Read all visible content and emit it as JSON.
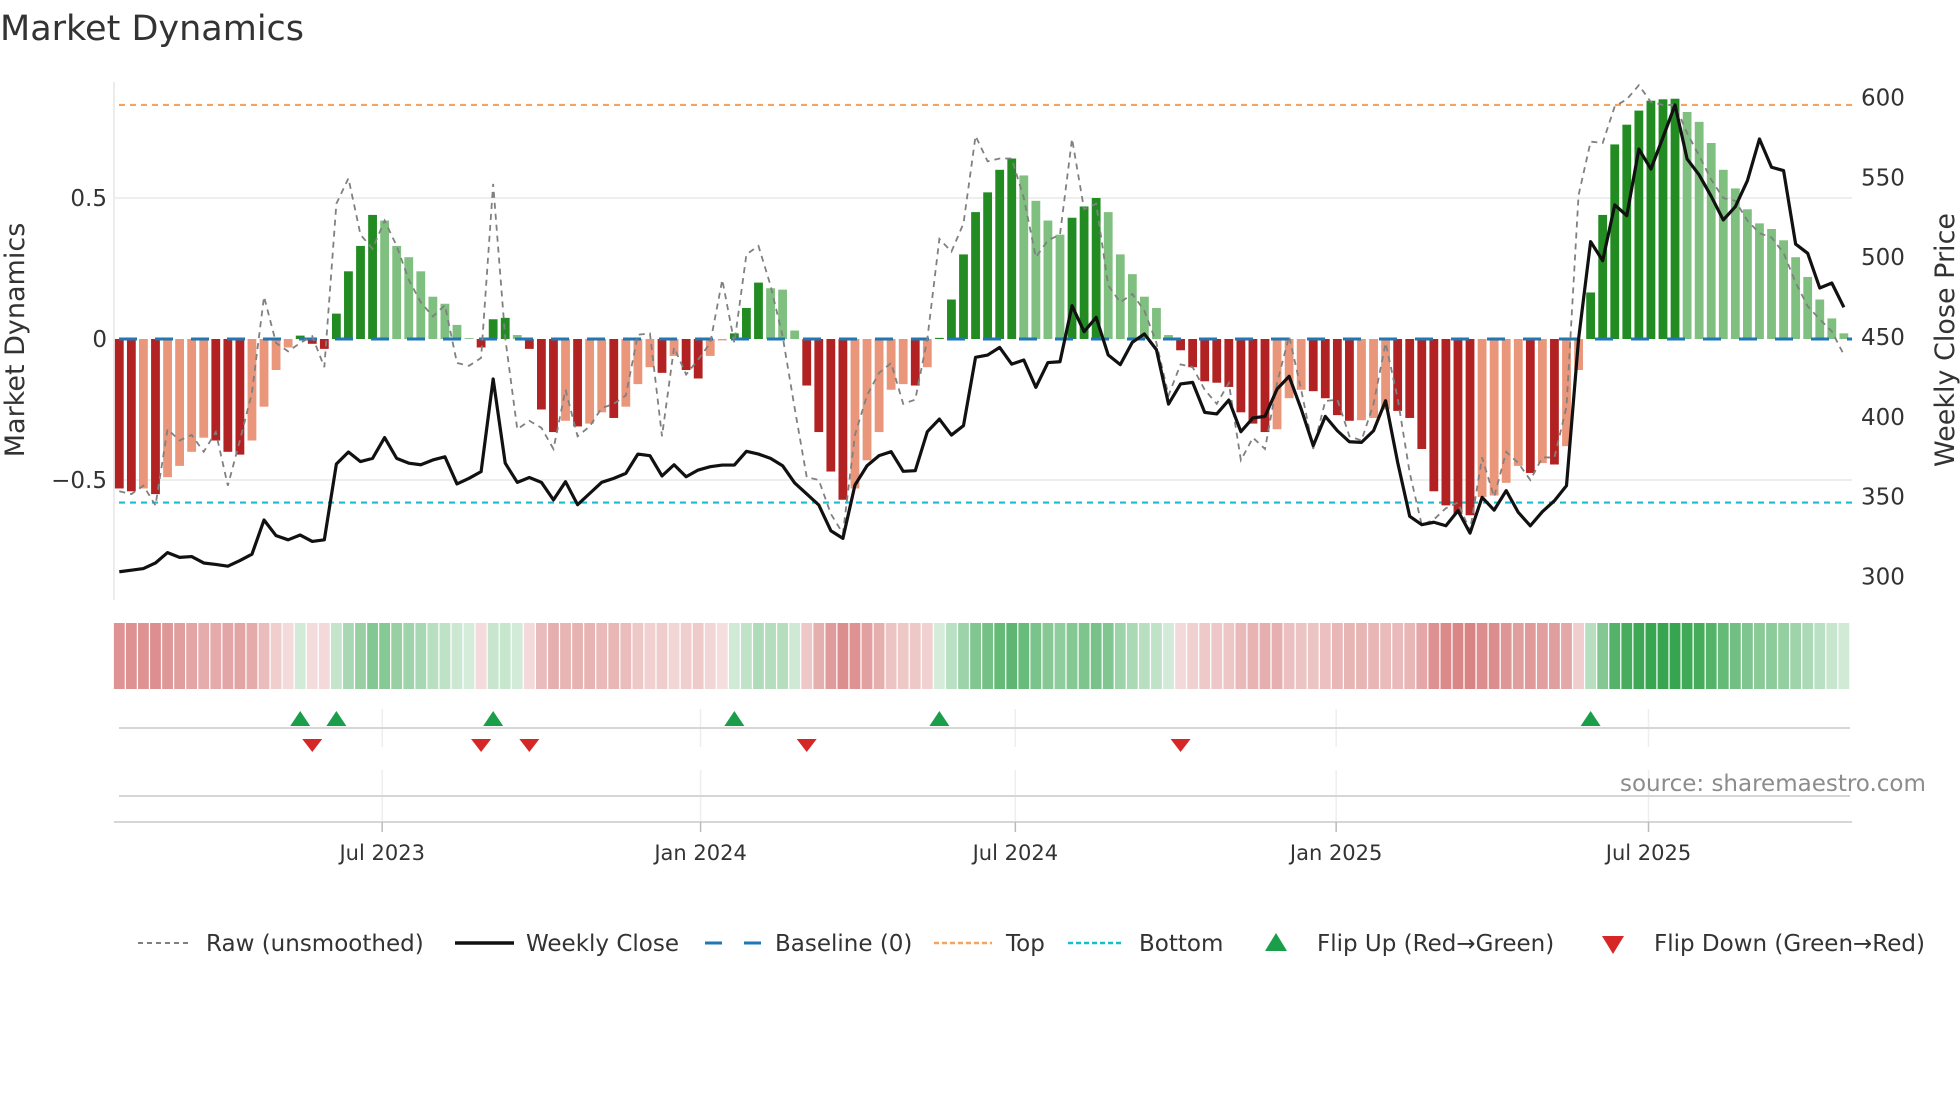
{
  "title": "Market Dynamics",
  "source": "source: sharemaestro.com",
  "colors": {
    "bar_neg_falling": "#b22222",
    "bar_neg_rising": "#e9967a",
    "bar_pos_rising": "#228b22",
    "bar_pos_falling": "#7fbf7f",
    "raw": "#808080",
    "close": "#111111",
    "baseline": "#1f77b4",
    "top": "#f4a460",
    "bottom": "#17becf",
    "flip_up": "#1a9e4a",
    "flip_down": "#d62728"
  },
  "chart_data": {
    "type": "bar",
    "title": "Market Dynamics",
    "ylabel": "Market Dynamics",
    "y2label": "Weekly Close Price",
    "ylim": [
      -0.92,
      0.91
    ],
    "y2lim": [
      282,
      610
    ],
    "yticks": [
      {
        "value": 0.5,
        "label": "0.5"
      },
      {
        "value": 0,
        "label": "0"
      },
      {
        "value": -0.5,
        "label": "−0.5"
      }
    ],
    "y2ticks": [
      {
        "value": 600,
        "label": "600"
      },
      {
        "value": 550,
        "label": "550"
      },
      {
        "value": 500,
        "label": "500"
      },
      {
        "value": 450,
        "label": "450"
      },
      {
        "value": 400,
        "label": "400"
      },
      {
        "value": 350,
        "label": "350"
      },
      {
        "value": 300,
        "label": "300"
      }
    ],
    "x_unit": "week index",
    "x_ticks": [
      {
        "label": "Jul 2023",
        "week": 21.8
      },
      {
        "label": "Jan 2024",
        "week": 48.2
      },
      {
        "label": "Jul 2024",
        "week": 74.3
      },
      {
        "label": "Jan 2025",
        "week": 100.9
      },
      {
        "label": "Jul 2025",
        "week": 126.8
      }
    ],
    "reference_lines": {
      "baseline": 0,
      "top": 0.83,
      "bottom": -0.58
    },
    "grid": true,
    "legend_position": "bottom",
    "legend": [
      {
        "key": "raw",
        "label": "Raw (unsmoothed)"
      },
      {
        "key": "close",
        "label": "Weekly Close"
      },
      {
        "key": "baseline",
        "label": "Baseline (0)"
      },
      {
        "key": "top",
        "label": "Top"
      },
      {
        "key": "bottom",
        "label": "Bottom"
      },
      {
        "key": "flip_up",
        "label": "Flip Up (Red→Green)"
      },
      {
        "key": "flip_down",
        "label": "Flip Down (Green→Red)"
      }
    ],
    "series": [
      {
        "name": "Market Dynamics",
        "values": [
          -0.53,
          -0.54,
          -0.53,
          -0.55,
          -0.49,
          -0.45,
          -0.4,
          -0.35,
          -0.36,
          -0.4,
          -0.41,
          -0.36,
          -0.24,
          -0.11,
          -0.03,
          0.012,
          -0.017,
          -0.035,
          0.09,
          0.24,
          0.33,
          0.44,
          0.42,
          0.33,
          0.29,
          0.24,
          0.15,
          0.125,
          0.05,
          0.003,
          -0.03,
          0.07,
          0.075,
          0.014,
          -0.035,
          -0.25,
          -0.33,
          -0.29,
          -0.31,
          -0.3,
          -0.26,
          -0.28,
          -0.24,
          -0.16,
          -0.1,
          -0.12,
          -0.06,
          -0.11,
          -0.14,
          -0.06,
          -0.005,
          0.02,
          0.11,
          0.2,
          0.18,
          0.175,
          0.03,
          -0.165,
          -0.33,
          -0.47,
          -0.57,
          -0.53,
          -0.43,
          -0.33,
          -0.18,
          -0.16,
          -0.165,
          -0.1,
          0.004,
          0.14,
          0.3,
          0.45,
          0.52,
          0.6,
          0.64,
          0.58,
          0.49,
          0.42,
          0.37,
          0.43,
          0.47,
          0.5,
          0.45,
          0.3,
          0.23,
          0.15,
          0.11,
          0.014,
          -0.04,
          -0.1,
          -0.15,
          -0.155,
          -0.17,
          -0.26,
          -0.3,
          -0.33,
          -0.32,
          -0.21,
          -0.18,
          -0.185,
          -0.21,
          -0.27,
          -0.29,
          -0.288,
          -0.28,
          -0.25,
          -0.255,
          -0.28,
          -0.39,
          -0.54,
          -0.59,
          -0.62,
          -0.625,
          -0.56,
          -0.555,
          -0.51,
          -0.45,
          -0.475,
          -0.44,
          -0.445,
          -0.38,
          -0.11,
          0.165,
          0.44,
          0.69,
          0.76,
          0.81,
          0.845,
          0.85,
          0.852,
          0.805,
          0.77,
          0.695,
          0.6,
          0.534,
          0.46,
          0.41,
          0.39,
          0.35,
          0.29,
          0.22,
          0.14,
          0.073,
          0.02
        ]
      },
      {
        "name": "Raw (unsmoothed)",
        "values": [
          -0.54,
          -0.55,
          -0.52,
          -0.59,
          -0.32,
          -0.36,
          -0.34,
          -0.4,
          -0.33,
          -0.52,
          -0.36,
          -0.19,
          0.15,
          -0.014,
          -0.044,
          -0.014,
          0.01,
          -0.1,
          0.48,
          0.57,
          0.37,
          0.32,
          0.42,
          0.33,
          0.21,
          0.13,
          0.08,
          0.12,
          -0.085,
          -0.095,
          -0.067,
          0.55,
          0.004,
          -0.32,
          -0.29,
          -0.315,
          -0.39,
          -0.18,
          -0.345,
          -0.31,
          -0.245,
          -0.23,
          -0.2,
          0.015,
          0.02,
          -0.345,
          -0.03,
          -0.126,
          -0.073,
          -0.014,
          0.21,
          -0.014,
          0.3,
          0.33,
          0.19,
          0.01,
          -0.245,
          -0.49,
          -0.5,
          -0.62,
          -0.69,
          -0.34,
          -0.2,
          -0.12,
          -0.085,
          -0.23,
          -0.215,
          0,
          0.355,
          0.31,
          0.41,
          0.72,
          0.63,
          0.64,
          0.64,
          0.5,
          0.29,
          0.35,
          0.37,
          0.71,
          0.46,
          0.48,
          0.19,
          0.13,
          0.16,
          0.1,
          -0.014,
          -0.2,
          -0.09,
          -0.1,
          -0.18,
          -0.23,
          -0.156,
          -0.43,
          -0.35,
          -0.39,
          -0.156,
          0.01,
          -0.18,
          -0.39,
          -0.22,
          -0.215,
          -0.345,
          -0.36,
          -0.23,
          -0.014,
          -0.21,
          -0.475,
          -0.66,
          -0.64,
          -0.6,
          -0.58,
          -0.68,
          -0.42,
          -0.56,
          -0.4,
          -0.44,
          -0.5,
          -0.42,
          -0.42,
          -0.24,
          0.51,
          0.7,
          0.695,
          0.825,
          0.85,
          0.9,
          0.84,
          0.83,
          0.83,
          0.73,
          0.65,
          0.565,
          0.5,
          0.49,
          0.42,
          0.375,
          0.36,
          0.305,
          0.2,
          0.116,
          0.07,
          0.027,
          -0.056
        ]
      },
      {
        "name": "Weekly Close",
        "axis": "right",
        "values": [
          303,
          304,
          305,
          308.5,
          315,
          312,
          312.5,
          308.5,
          307.6,
          306.5,
          310,
          314,
          335.4,
          325.6,
          323,
          326,
          322,
          323,
          370.5,
          378,
          372,
          374,
          387,
          374,
          371,
          370,
          373,
          375,
          358,
          361.5,
          365.7,
          423.7,
          371,
          359,
          362,
          359,
          348,
          359.4,
          345,
          352,
          359,
          361.5,
          364.6,
          376.7,
          375.7,
          363,
          370,
          362.5,
          366.7,
          368.8,
          369.8,
          369.8,
          378.4,
          376.7,
          374,
          369.4,
          358.6,
          351.7,
          344.8,
          328.7,
          323.9,
          357.3,
          369.4,
          375.7,
          378.2,
          365.9,
          366.3,
          390.7,
          398.6,
          388.6,
          394.5,
          437.3,
          438.7,
          443.5,
          433,
          435.6,
          418.5,
          434,
          434.5,
          469.6,
          453.3,
          462.3,
          438.7,
          432.7,
          446.7,
          451.9,
          442,
          408,
          420.6,
          421.6,
          402.8,
          401.8,
          410.5,
          390.7,
          399.3,
          400.3,
          417.4,
          425.4,
          404.9,
          382,
          400.3,
          391.3,
          384.4,
          384,
          391.3,
          410.1,
          371.5,
          337.7,
          332.5,
          334,
          331.8,
          341.2,
          327.2,
          349.6,
          341.6,
          353.8,
          340.2,
          331.8,
          340.6,
          347.5,
          356.9,
          448.7,
          509.7,
          497.8,
          532.7,
          526,
          567.7,
          555.2,
          575,
          595.3,
          561.5,
          551.5,
          538.1,
          523.3,
          531.6,
          547.9,
          574,
          556.3,
          554.2,
          508.2,
          502.4,
          480.7,
          483.8,
          468.6
        ]
      }
    ]
  }
}
